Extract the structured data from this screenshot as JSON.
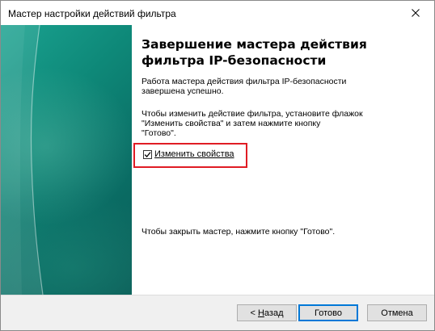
{
  "window": {
    "title": "Мастер настройки действий фильтра"
  },
  "content": {
    "heading_line1": "Завершение мастера действия",
    "heading_line2": "фильтра  IP-безопасности",
    "para1_line1": "Работа мастера действия фильтра  IP-безопасности",
    "para1_line2": "завершена успешно.",
    "para2_line1": "Чтобы изменить действие фильтра, установите флажок",
    "para2_line2": "\"Изменить свойства\" и затем нажмите кнопку",
    "para2_line3": "\"Готово\".",
    "checkbox_label": "Изменить свойства",
    "checkbox_checked": true,
    "para3": "Чтобы закрыть мастер, нажмите кнопку \"Готово\"."
  },
  "buttons": {
    "back_prefix": "< ",
    "back_accel": "Н",
    "back_rest": "азад",
    "done": "Готово",
    "cancel": "Отмена"
  },
  "colors": {
    "banner": "#0e8878",
    "highlight": "#e01c24",
    "default_button_border": "#0078d7"
  }
}
